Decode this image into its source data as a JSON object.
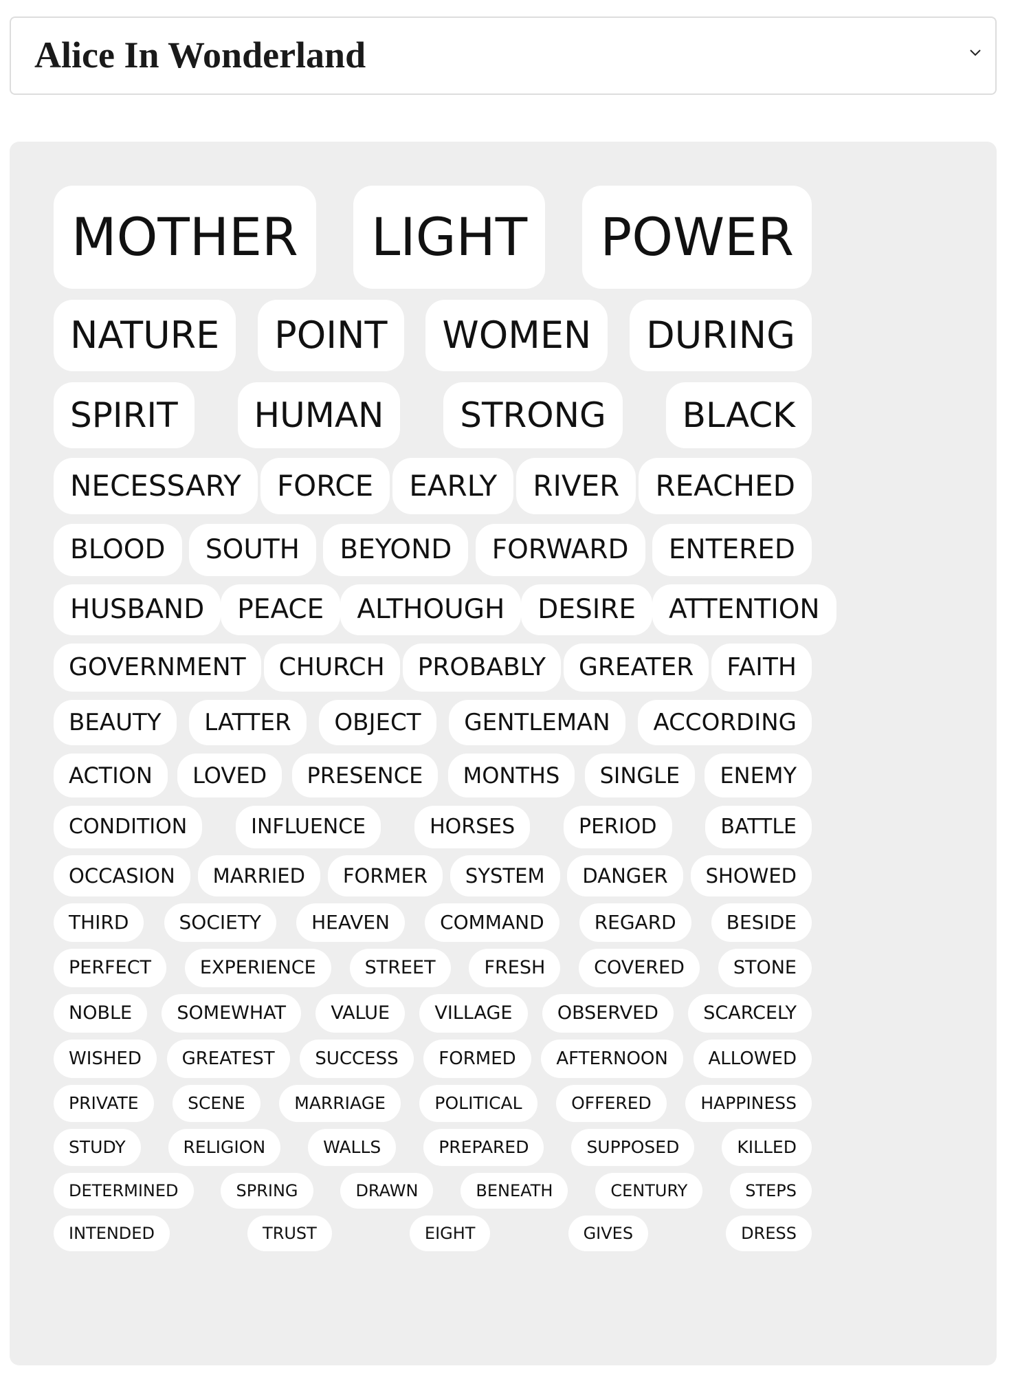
{
  "selector": {
    "selected": "Alice In Wonderland"
  },
  "word_rows": [
    [
      "MOTHER",
      "LIGHT",
      "POWER"
    ],
    [
      "NATURE",
      "POINT",
      "WOMEN",
      "DURING"
    ],
    [
      "SPIRIT",
      "HUMAN",
      "STRONG",
      "BLACK"
    ],
    [
      "NECESSARY",
      "FORCE",
      "EARLY",
      "RIVER",
      "REACHED"
    ],
    [
      "BLOOD",
      "SOUTH",
      "BEYOND",
      "FORWARD",
      "ENTERED"
    ],
    [
      "HUSBAND",
      "PEACE",
      "ALTHOUGH",
      "DESIRE",
      "ATTENTION"
    ],
    [
      "GOVERNMENT",
      "CHURCH",
      "PROBABLY",
      "GREATER",
      "FAITH"
    ],
    [
      "BEAUTY",
      "LATTER",
      "OBJECT",
      "GENTLEMAN",
      "ACCORDING"
    ],
    [
      "ACTION",
      "LOVED",
      "PRESENCE",
      "MONTHS",
      "SINGLE",
      "ENEMY"
    ],
    [
      "CONDITION",
      "INFLUENCE",
      "HORSES",
      "PERIOD",
      "BATTLE"
    ],
    [
      "OCCASION",
      "MARRIED",
      "FORMER",
      "SYSTEM",
      "DANGER",
      "SHOWED"
    ],
    [
      "THIRD",
      "SOCIETY",
      "HEAVEN",
      "COMMAND",
      "REGARD",
      "BESIDE"
    ],
    [
      "PERFECT",
      "EXPERIENCE",
      "STREET",
      "FRESH",
      "COVERED",
      "STONE"
    ],
    [
      "NOBLE",
      "SOMEWHAT",
      "VALUE",
      "VILLAGE",
      "OBSERVED",
      "SCARCELY"
    ],
    [
      "WISHED",
      "GREATEST",
      "SUCCESS",
      "FORMED",
      "AFTERNOON",
      "ALLOWED"
    ],
    [
      "PRIVATE",
      "SCENE",
      "MARRIAGE",
      "POLITICAL",
      "OFFERED",
      "HAPPINESS"
    ],
    [
      "STUDY",
      "RELIGION",
      "WALLS",
      "PREPARED",
      "SUPPOSED",
      "KILLED"
    ],
    [
      "DETERMINED",
      "SPRING",
      "DRAWN",
      "BENEATH",
      "CENTURY",
      "STEPS"
    ],
    [
      "INTENDED",
      "TRUST",
      "EIGHT",
      "GIVES",
      "DRESS"
    ]
  ]
}
